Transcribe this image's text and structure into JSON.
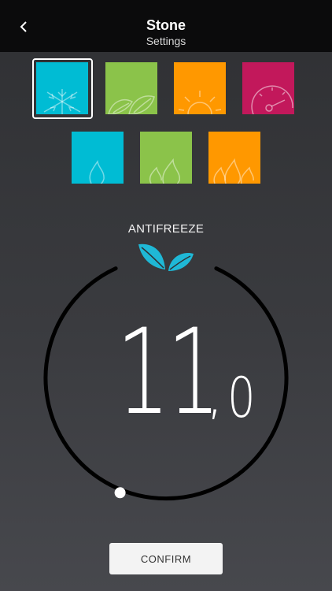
{
  "header": {
    "title": "Stone",
    "subtitle": "Settings",
    "back_icon": "chevron-left-icon"
  },
  "modes": [
    {
      "name": "antifreeze-snowflake",
      "color": "#00bcd4",
      "icon": "snowflake-icon",
      "selected": true
    },
    {
      "name": "eco-leaves",
      "color": "#8bc34a",
      "icon": "leaves-icon",
      "selected": false
    },
    {
      "name": "comfort-sun",
      "color": "#ff9800",
      "icon": "sun-icon",
      "selected": false
    },
    {
      "name": "boost-gauge",
      "color": "#c2185b",
      "icon": "gauge-icon",
      "selected": false
    },
    {
      "name": "flame-low",
      "color": "#00bcd4",
      "icon": "flame-icon",
      "selected": false
    },
    {
      "name": "flame-medium",
      "color": "#8bc34a",
      "icon": "double-flame-icon",
      "selected": false
    },
    {
      "name": "flame-high",
      "color": "#ff9800",
      "icon": "triple-flame-icon",
      "selected": false
    }
  ],
  "current_mode": {
    "label": "ANTIFREEZE",
    "icon": "leaves-icon",
    "icon_color": "#1fb8d6"
  },
  "temperature": {
    "integer": "11",
    "separator": ",",
    "decimal": "0",
    "dial_level_fraction": 0.09
  },
  "confirm_label": "CONFIRM"
}
